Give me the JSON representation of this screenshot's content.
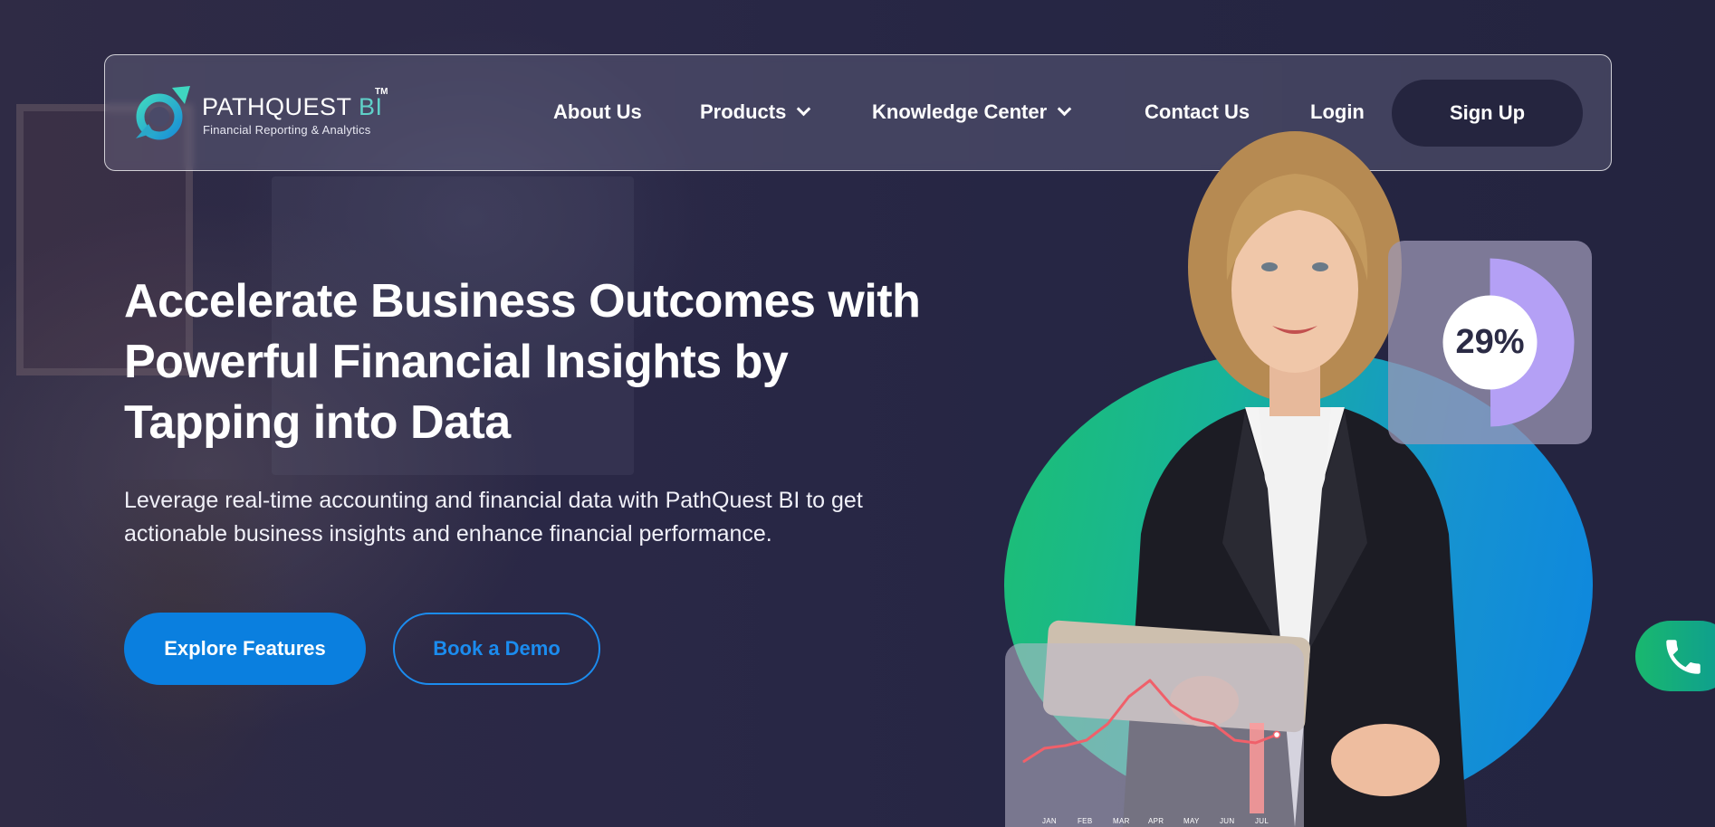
{
  "nav": {
    "logo": {
      "brand_part1": "PATHQUEST",
      "brand_part2": "BI",
      "trademark": "TM",
      "tagline": "Financial Reporting & Analytics"
    },
    "items": [
      {
        "label": "About Us",
        "has_dropdown": false
      },
      {
        "label": "Products",
        "has_dropdown": true
      },
      {
        "label": "Knowledge Center",
        "has_dropdown": true
      },
      {
        "label": "Contact Us",
        "has_dropdown": false
      },
      {
        "label": "Login",
        "has_dropdown": false
      }
    ],
    "signup_label": "Sign Up"
  },
  "hero": {
    "title_lines": [
      "Accelerate Business Outcomes with",
      "Powerful Financial Insights by",
      "Tapping into Data"
    ],
    "subtitle_lines": [
      "Leverage real-time accounting and financial data with PathQuest BI to get",
      "actionable business insights and enhance financial performance."
    ],
    "primary_button": "Explore Features",
    "secondary_button": "Book a Demo"
  },
  "stats_card": {
    "percent_label": "29%",
    "percent_value": 29
  },
  "chart_data": {
    "type": "line",
    "categories": [
      "JAN",
      "FEB",
      "MAR",
      "APR",
      "MAY",
      "JUN",
      "JUL"
    ],
    "values": [
      20,
      35,
      55,
      95,
      60,
      40,
      45
    ],
    "highlight_category": "JUL"
  },
  "colors": {
    "background": "#272744",
    "primary_blue": "#0a7fdf",
    "signup_bg": "#25253f",
    "logo_accent": "#5fd0c8",
    "donut_fill": "#b4a0f5",
    "chart_line": "#f0606a",
    "chart_highlight": "#ff9a9a",
    "phone_green": "#19b86e"
  },
  "icons": {
    "chevron": "chevron-down-icon",
    "phone": "phone-icon",
    "logo": "pathquest-logo-icon"
  }
}
